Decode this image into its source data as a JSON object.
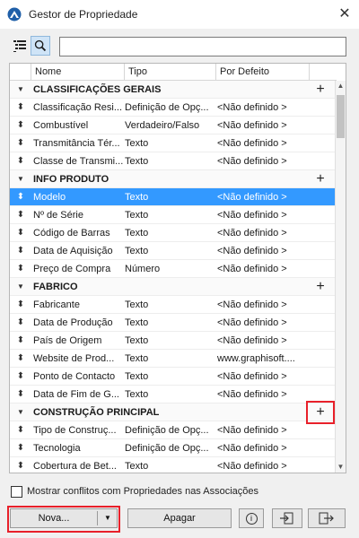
{
  "window": {
    "title": "Gestor de Propriedade",
    "close_icon": "close-icon"
  },
  "search": {
    "value": "",
    "placeholder": ""
  },
  "table": {
    "columns": [
      "Nome",
      "Tipo",
      "Por Defeito"
    ],
    "rows": [
      {
        "kind": "group",
        "name": "CLASSIFICAÇÕES GERAIS",
        "add": "+"
      },
      {
        "kind": "item",
        "name": "Classificação Resi...",
        "type": "Definição de Opç...",
        "default": "<Não definido >"
      },
      {
        "kind": "item",
        "name": "Combustível",
        "type": "Verdadeiro/Falso",
        "default": "<Não definido >"
      },
      {
        "kind": "item",
        "name": "Transmitância Tér...",
        "type": "Texto",
        "default": "<Não definido >"
      },
      {
        "kind": "item",
        "name": "Classe de Transmi...",
        "type": "Texto",
        "default": "<Não definido >"
      },
      {
        "kind": "group",
        "name": "INFO PRODUTO",
        "add": "+"
      },
      {
        "kind": "item",
        "name": "Modelo",
        "type": "Texto",
        "default": "<Não definido >",
        "selected": true
      },
      {
        "kind": "item",
        "name": "Nº de Série",
        "type": "Texto",
        "default": "<Não definido >"
      },
      {
        "kind": "item",
        "name": "Código de Barras",
        "type": "Texto",
        "default": "<Não definido >"
      },
      {
        "kind": "item",
        "name": "Data de Aquisição",
        "type": "Texto",
        "default": "<Não definido >"
      },
      {
        "kind": "item",
        "name": "Preço de Compra",
        "type": "Número",
        "default": "<Não definido >"
      },
      {
        "kind": "group",
        "name": "FABRICO",
        "add": "+"
      },
      {
        "kind": "item",
        "name": "Fabricante",
        "type": "Texto",
        "default": "<Não definido >"
      },
      {
        "kind": "item",
        "name": "Data de Produção",
        "type": "Texto",
        "default": "<Não definido >"
      },
      {
        "kind": "item",
        "name": "País de Origem",
        "type": "Texto",
        "default": "<Não definido >"
      },
      {
        "kind": "item",
        "name": "Website de Prod...",
        "type": "Texto",
        "default": "www.graphisoft...."
      },
      {
        "kind": "item",
        "name": "Ponto de Contacto",
        "type": "Texto",
        "default": "<Não definido >"
      },
      {
        "kind": "item",
        "name": "Data de Fim de G...",
        "type": "Texto",
        "default": "<Não definido >"
      },
      {
        "kind": "group",
        "name": "CONSTRUÇÃO PRINCIPAL",
        "add": "+"
      },
      {
        "kind": "item",
        "name": "Tipo de Construç...",
        "type": "Definição de Opç...",
        "default": "<Não definido >"
      },
      {
        "kind": "item",
        "name": "Tecnologia",
        "type": "Definição de Opç...",
        "default": "<Não definido >"
      },
      {
        "kind": "item",
        "name": "Cobertura de Bet...",
        "type": "Texto",
        "default": "<Não definido >"
      }
    ]
  },
  "footer": {
    "conflicts_label": "Mostrar conflitos com Propriedades nas Associações",
    "conflicts_checked": false,
    "nova_label": "Nova...",
    "apagar_label": "Apagar"
  },
  "colors": {
    "selection": "#3399ff",
    "highlight": "#e8202a"
  }
}
